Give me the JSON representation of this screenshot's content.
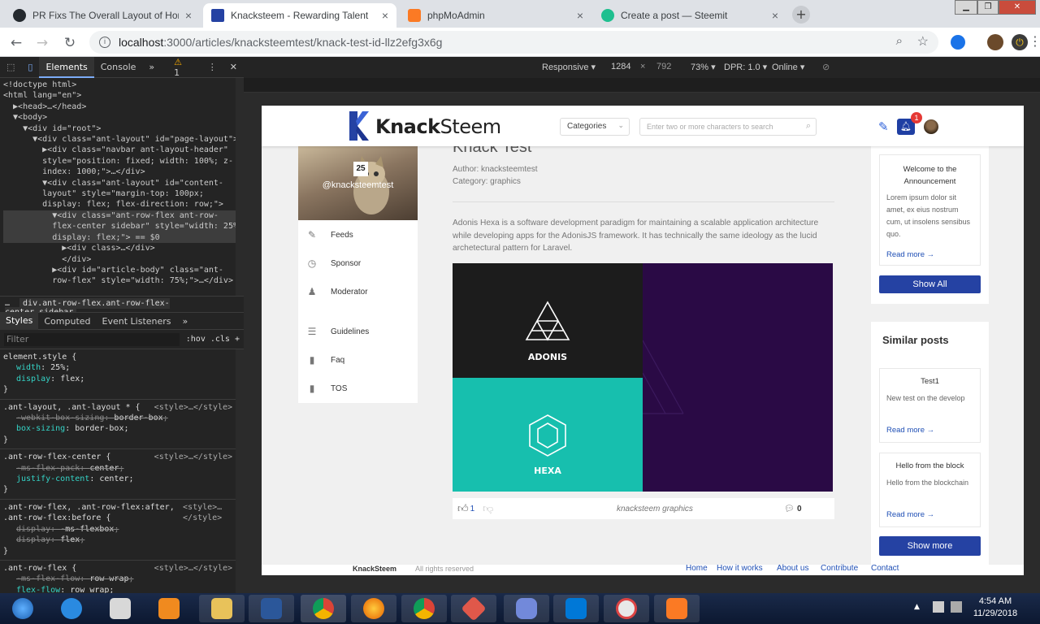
{
  "browser": {
    "tabs": [
      {
        "title": "PR Fixs The Overall Layout of Hom",
        "icon": "github-icon",
        "color": "#24292e"
      },
      {
        "title": "Knacksteem - Rewarding Talent",
        "icon": "knacksteem-icon",
        "color": "#2542a3"
      },
      {
        "title": "phpMoAdmin",
        "icon": "xampp-icon",
        "color": "#fb7a24"
      },
      {
        "title": "Create a post — Steemit",
        "icon": "steemit-icon",
        "color": "#1fbf8f"
      }
    ],
    "close_glyph": "×",
    "new_tab_glyph": "+",
    "url_host": "localhost",
    "url_path": ":3000/articles/knacksteemtest/knack-test-id-llz2efg3x6g"
  },
  "devtools": {
    "tabs": [
      "Elements",
      "Console",
      "»"
    ],
    "warning_count": "1",
    "dom_lines": [
      "<!doctype html>",
      "<html lang=\"en\">",
      "  ▶<head>…</head>",
      "  ▼<body>",
      "    ▼<div id=\"root\">",
      "      ▼<div class=\"ant-layout\" id=\"page-layout\">",
      "        ▶<div class=\"navbar ant-layout-header\"",
      "        style=\"position: fixed; width: 100%; z-",
      "        index: 1000;\">…</div>",
      "        ▼<div class=\"ant-layout\" id=\"content-",
      "        layout\" style=\"margin-top: 100px;",
      "        display: flex; flex-direction: row;\">",
      "          ▼<div class=\"ant-row-flex ant-row-",
      "          flex-center sidebar\" style=\"width: 25%;",
      "          display: flex;\"> == $0",
      "            ▶<div class>…</div>",
      "            </div>",
      "          ▶<div id=\"article-body\" class=\"ant-",
      "          row-flex\" style=\"width: 75%;\">…</div>"
    ],
    "breadcrumb": "div.ant-row-flex.ant-row-flex-center.sidebar",
    "style_tabs": [
      "Styles",
      "Computed",
      "Event Listeners",
      "»"
    ],
    "filter_placeholder": "Filter",
    "filter_tools": ":hov  .cls  +",
    "rules": [
      {
        "selector": "element.style {",
        "source": "",
        "props": [
          [
            "width",
            "25%",
            false
          ],
          [
            "display",
            "flex",
            false
          ]
        ]
      },
      {
        "selector": ".ant-layout, .ant-layout * {",
        "source": "<style>…</style>",
        "props": [
          [
            "-webkit-box-sizing",
            "border-box",
            true
          ],
          [
            "box-sizing",
            "border-box",
            false
          ]
        ]
      },
      {
        "selector": ".ant-row-flex-center {",
        "source": "<style>…</style>",
        "props": [
          [
            "-ms-flex-pack",
            "center",
            true
          ],
          [
            "justify-content",
            "center",
            false
          ]
        ]
      },
      {
        "selector": ".ant-row-flex, .ant-row-flex:after, .ant-row-flex:before {",
        "source": "<style>…</style>",
        "props": [
          [
            "display",
            "-ms-flexbox",
            true
          ],
          [
            "display",
            "flex",
            true
          ]
        ]
      },
      {
        "selector": ".ant-row-flex {",
        "source": "<style>…</style>",
        "props": [
          [
            "-ms-flex-flow",
            "row wrap",
            true
          ],
          [
            "flex-flow",
            "row wrap",
            false
          ]
        ]
      }
    ]
  },
  "device_toolbar": {
    "mode": "Responsive ▾",
    "width": "1284",
    "times": "×",
    "height": "792",
    "zoom": "73% ▾",
    "dpr": "DPR: 1.0 ▾",
    "network": "Online ▾"
  },
  "site": {
    "logo_bold": "Knack",
    "logo_thin": "Steem",
    "categories_label": "Categories",
    "search_placeholder": "Enter two or more characters to search",
    "notification_count": "1",
    "sidebar": {
      "hero_number": "25",
      "hero_handle": "@knacksteemtest",
      "items": [
        {
          "label": "Feeds",
          "icon": "pencil-icon"
        },
        {
          "label": "Sponsor",
          "icon": "clock-icon"
        },
        {
          "label": "Moderator",
          "icon": "user-icon"
        },
        {
          "label": "Guidelines",
          "icon": "list-icon"
        },
        {
          "label": "Faq",
          "icon": "file-icon"
        },
        {
          "label": "TOS",
          "icon": "file-icon"
        }
      ]
    },
    "article": {
      "title": "Knack Test",
      "author": "Author: knacksteemtest",
      "category": "Category: graphics",
      "body": "Adonis Hexa is a software development paradigm for maintaining a scalable application architecture while developing apps for the AdonisJS framework. It has technically the same ideology as the lucid archetectural pattern for Laravel.",
      "figure_top_label": "ADONIS",
      "figure_bottom_label": "HEXA",
      "likes": "1",
      "tags": "knacksteem graphics",
      "comments": "0"
    },
    "announcement": {
      "title": "Welcome to the Announcement",
      "body": "Lorem ipsum dolor sit amet, ex eius nostrum cum, ut insolens sensibus quo.",
      "read_more": "Read more →",
      "button": "Show All"
    },
    "similar": {
      "heading": "Similar posts",
      "posts": [
        {
          "title": "Test1",
          "body": "New test on the develop",
          "read_more": "Read more →"
        },
        {
          "title": "Hello from the block",
          "body": "Hello from the blockchain",
          "read_more": "Read more →"
        }
      ],
      "button": "Show more"
    },
    "footer": {
      "brand": "KnackSteem",
      "rights": "All rights reserved",
      "links": [
        "Home",
        "How it works",
        "About us",
        "Contribute",
        "Contact"
      ]
    }
  },
  "taskbar": {
    "time": "4:54 AM",
    "date": "11/29/2018"
  }
}
